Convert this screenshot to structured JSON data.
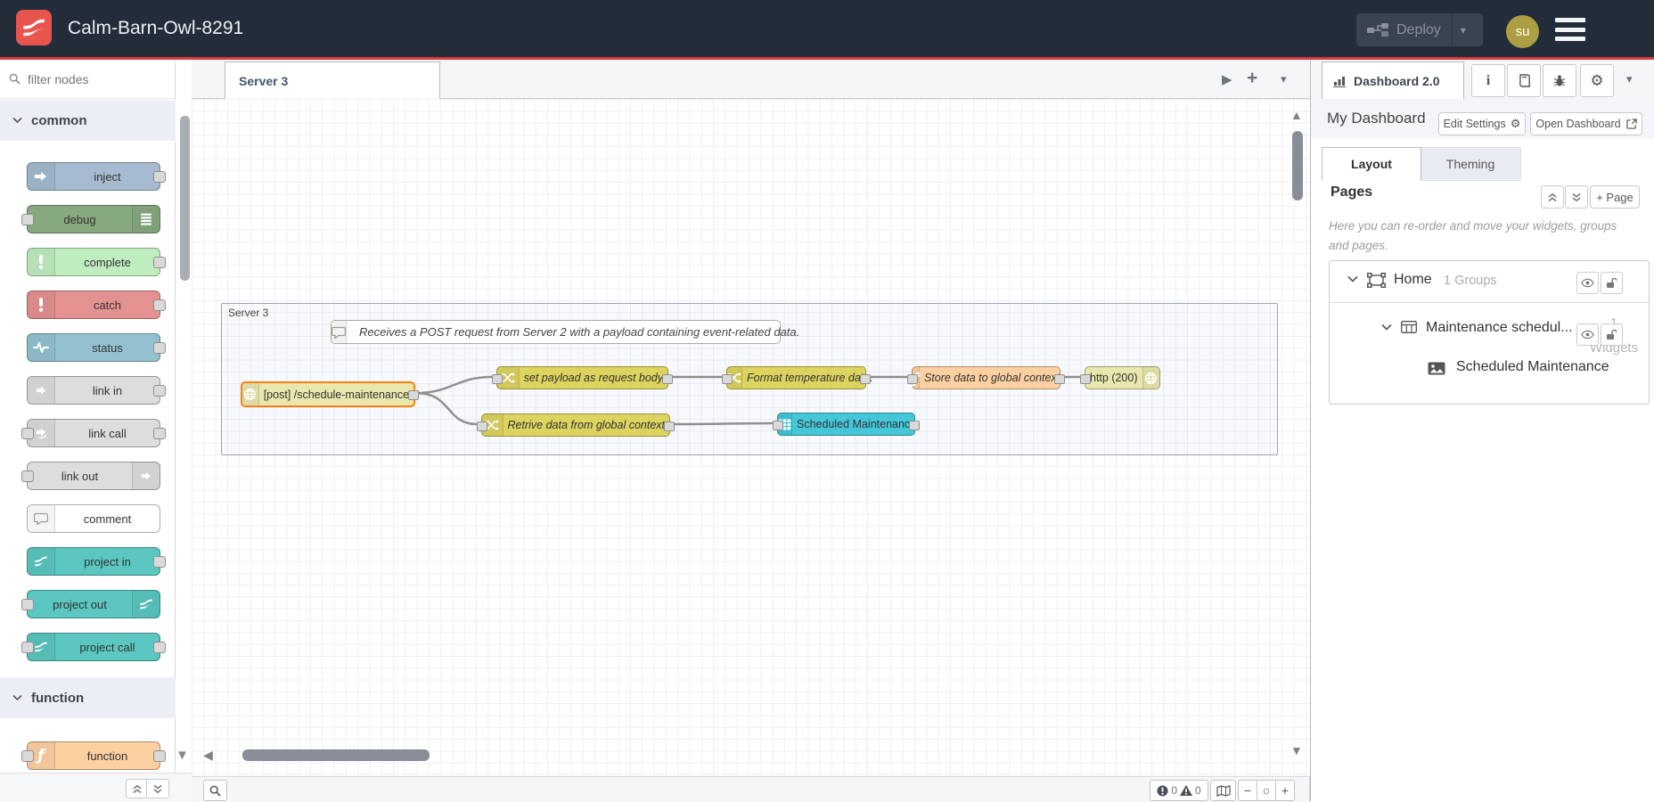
{
  "header": {
    "title": "Calm-Barn-Owl-8291",
    "deploy_label": "Deploy",
    "avatar_initials": "su"
  },
  "palette": {
    "filter_placeholder": "filter nodes",
    "category_common": "common",
    "category_function": "function",
    "nodes": {
      "inject": "inject",
      "debug": "debug",
      "complete": "complete",
      "catch": "catch",
      "status": "status",
      "link_in": "link in",
      "link_call": "link call",
      "link_out": "link out",
      "comment": "comment",
      "project_in": "project in",
      "project_out": "project out",
      "project_call": "project call",
      "function": "function"
    }
  },
  "workspace": {
    "tab_label": "Server 3",
    "group_label": "Server 3",
    "comment_text": "Receives a POST request from Server 2 with a payload containing event-related data.",
    "nodes": {
      "http_in": "[post] /schedule-maintenance",
      "set_payload": "set payload as request body",
      "format_temp": "Format temperature data.",
      "store_global": "Store data to global context",
      "http_response": "http (200)",
      "retrieve_global": "Retrive data from global context",
      "ui_table": "Scheduled Maintenance"
    },
    "footer": {
      "error_count": "0",
      "warning_count": "0",
      "zoom_out": "−",
      "zoom_reset": "○",
      "zoom_in": "+"
    }
  },
  "sidebar": {
    "tab_label": "Dashboard 2.0",
    "dashboard_name": "My Dashboard",
    "edit_settings_label": "Edit Settings",
    "open_dashboard_label": "Open Dashboard",
    "tabs": {
      "layout": "Layout",
      "theming": "Theming"
    },
    "pages_title": "Pages",
    "add_page_label": "+ Page",
    "help_text": "Here you can re-order and move your widgets, groups and pages.",
    "tree": {
      "page_name": "Home",
      "page_meta": "1 Groups",
      "group_name": "Maintenance schedul...",
      "group_meta_count": "1",
      "group_meta_label": "Widgets",
      "widget_name": "Scheduled Maintenance"
    }
  },
  "colors": {
    "header_bg": "#232c39",
    "accent_red": "#d43b3b",
    "logo_red": "#e8544e",
    "avatar_bg": "#ac9e42",
    "node_inject": "#a6bbcf",
    "node_debug": "#87a980",
    "node_complete": "#c0edc0",
    "node_catch": "#e49191",
    "node_status": "#94c1d0",
    "node_link": "#dddddd",
    "node_project": "#5bc7c0",
    "node_function": "#fdd0a2",
    "node_change": "#ddd35f",
    "node_http": "#e7e7ae",
    "node_table": "#45c7da",
    "selected_border": "#ff7f0e",
    "wire": "#909090"
  }
}
